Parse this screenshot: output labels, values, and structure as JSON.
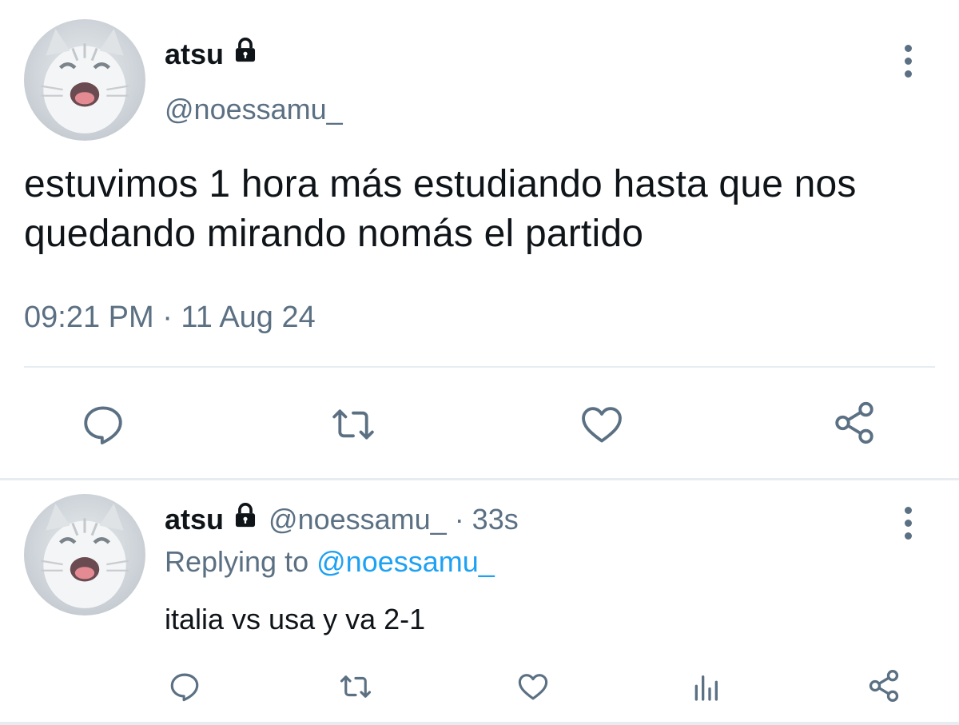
{
  "main_tweet": {
    "display_name": "atsu",
    "handle": "@noessamu_",
    "text": "estuvimos 1 hora más estudiando hasta que nos quedando mirando nomás el partido",
    "timestamp": "09:21 PM · 11 Aug 24",
    "actions": [
      "reply-icon",
      "retweet-icon",
      "like-icon",
      "share-icon"
    ]
  },
  "reply_tweet": {
    "display_name": "atsu",
    "handle_time": "@noessamu_ · 33s",
    "replying_prefix": "Replying to",
    "replying_handle": "@noessamu_",
    "text": "italia vs usa y va 2-1",
    "actions": [
      "reply-icon",
      "retweet-icon",
      "like-icon",
      "analytics-icon",
      "share-icon"
    ]
  },
  "colors": {
    "text": "#0f1419",
    "secondary": "#5b7083",
    "link": "#1da1f2",
    "divider": "#e6ecf0"
  }
}
